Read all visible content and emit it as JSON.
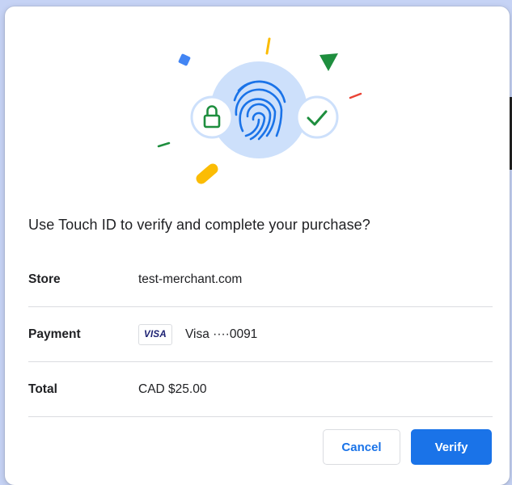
{
  "dialog": {
    "title": "Use Touch ID to verify and complete your purchase?",
    "illustration": {
      "center_icon": "fingerprint-icon",
      "left_icon": "lock-icon",
      "right_icon": "checkmark-icon",
      "colors": {
        "circle": "#cde0fb",
        "fingerprint": "#1a73e8",
        "green": "#1e8e3e",
        "blue": "#4285f4",
        "yellow": "#fbbc04",
        "red": "#ea4335"
      }
    },
    "rows": [
      {
        "label": "Store",
        "value": "test-merchant.com"
      },
      {
        "label": "Payment",
        "card_brand": "VISA",
        "value": "Visa ····0091"
      },
      {
        "label": "Total",
        "value": "CAD $25.00"
      }
    ],
    "buttons": {
      "cancel": "Cancel",
      "verify": "Verify"
    }
  }
}
